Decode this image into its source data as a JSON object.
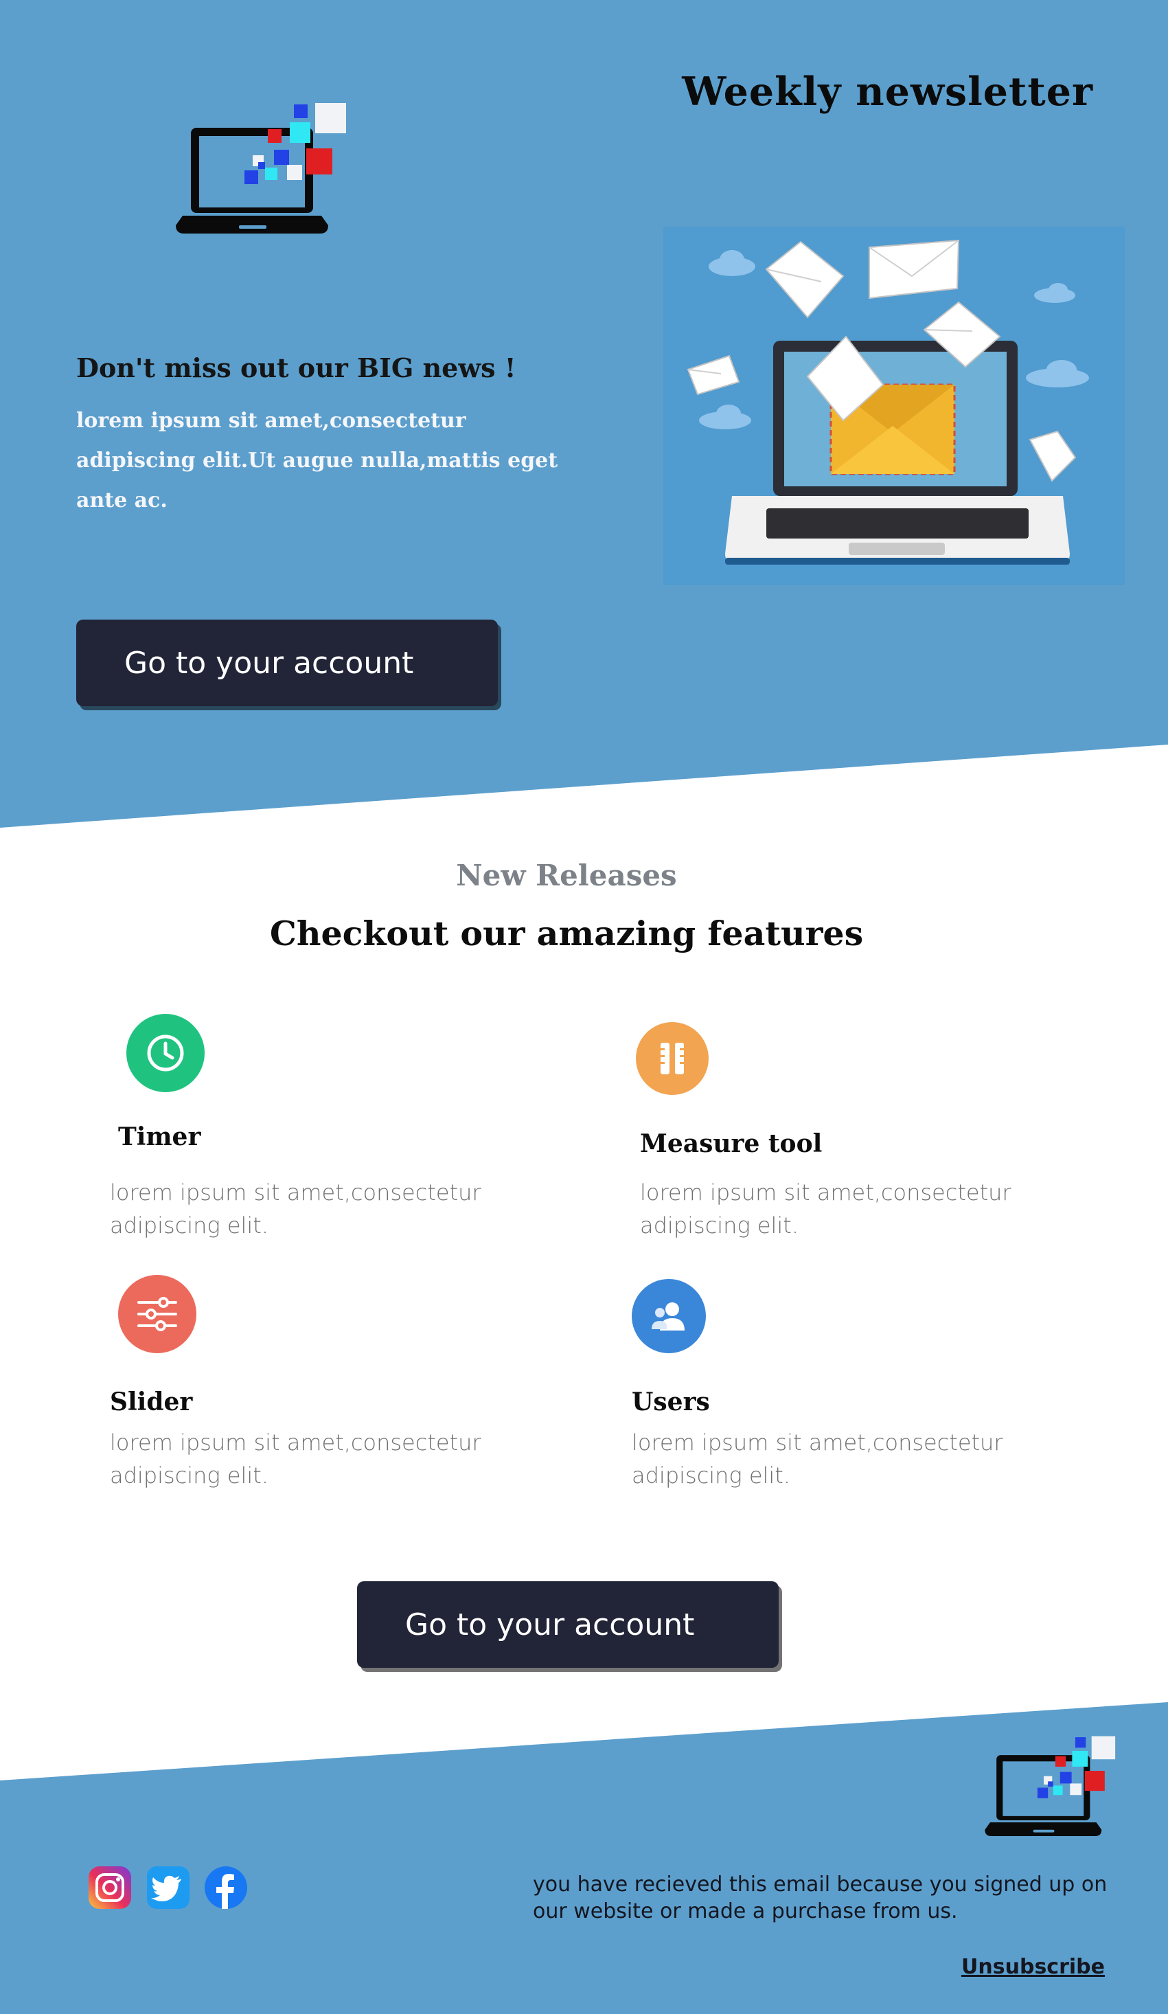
{
  "header": {
    "title": "Weekly newsletter",
    "logo_icon": "laptop-pixels-icon",
    "hero_image": "laptop-envelopes-illustration"
  },
  "hero": {
    "headline": "Don't miss out our BIG news !",
    "text": "lorem ipsum sit amet,consectetur adipiscing elit.Ut augue nulla,mattis eget ante ac.",
    "button_label": "Go to your account"
  },
  "features_section": {
    "eyebrow": "New Releases",
    "title": "Checkout our amazing features",
    "items": [
      {
        "title": "Timer",
        "description": "lorem ipsum sit amet,consectetur adipiscing elit.",
        "icon": "clock-icon",
        "color": "#1fc37f"
      },
      {
        "title": "Measure tool",
        "description": "lorem ipsum sit amet,consectetur adipiscing elit.",
        "icon": "ruler-icon",
        "color": "#f3a451"
      },
      {
        "title": "Slider",
        "description": "lorem ipsum sit amet,consectetur adipiscing elit.",
        "icon": "sliders-icon",
        "color": "#ec6a5c"
      },
      {
        "title": "Users",
        "description": "lorem ipsum sit amet,consectetur adipiscing elit.",
        "icon": "users-icon",
        "color": "#3a86d9"
      }
    ],
    "button_label": "Go to your account"
  },
  "footer": {
    "social": [
      "instagram-icon",
      "twitter-icon",
      "facebook-icon"
    ],
    "note": "you have recieved this email because you signed up on our website or made a purchase from us.",
    "unsubscribe": "Unsubscribe"
  },
  "colors": {
    "background_blue": "#5c9fcd",
    "button_dark": "#222437",
    "eyebrow_gray": "#7d8289"
  }
}
